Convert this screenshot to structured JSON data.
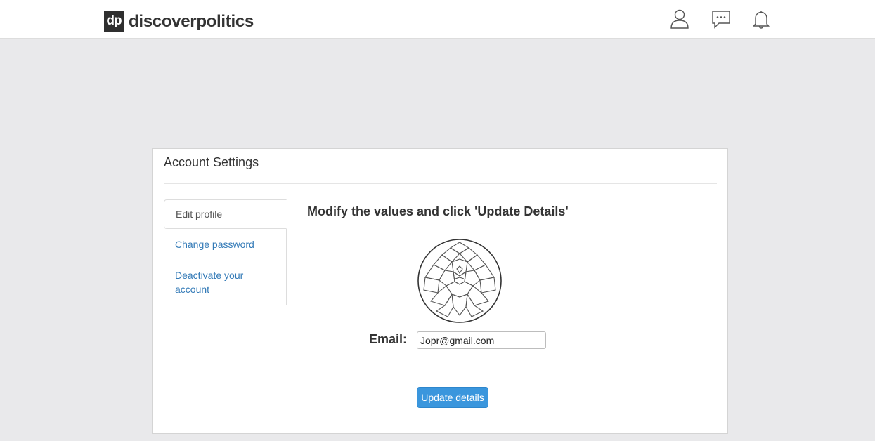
{
  "header": {
    "logo_badge": "dp",
    "logo_text": "discoverpolitics",
    "icons": [
      "user-icon",
      "chat-icon",
      "bell-icon"
    ]
  },
  "card": {
    "title": "Account Settings"
  },
  "sidebar": {
    "items": [
      {
        "label": "Edit profile",
        "active": true
      },
      {
        "label": "Change password",
        "active": false
      },
      {
        "label": "Deactivate your account",
        "active": false
      }
    ]
  },
  "form": {
    "heading": "Modify the values and click 'Update Details'",
    "email_label": "Email:",
    "email_value": "Jopr@gmail.com",
    "submit_label": "Update details"
  },
  "colors": {
    "page_background": "#e9e9eb",
    "link": "#337ab7",
    "button": "#3a96dd"
  }
}
